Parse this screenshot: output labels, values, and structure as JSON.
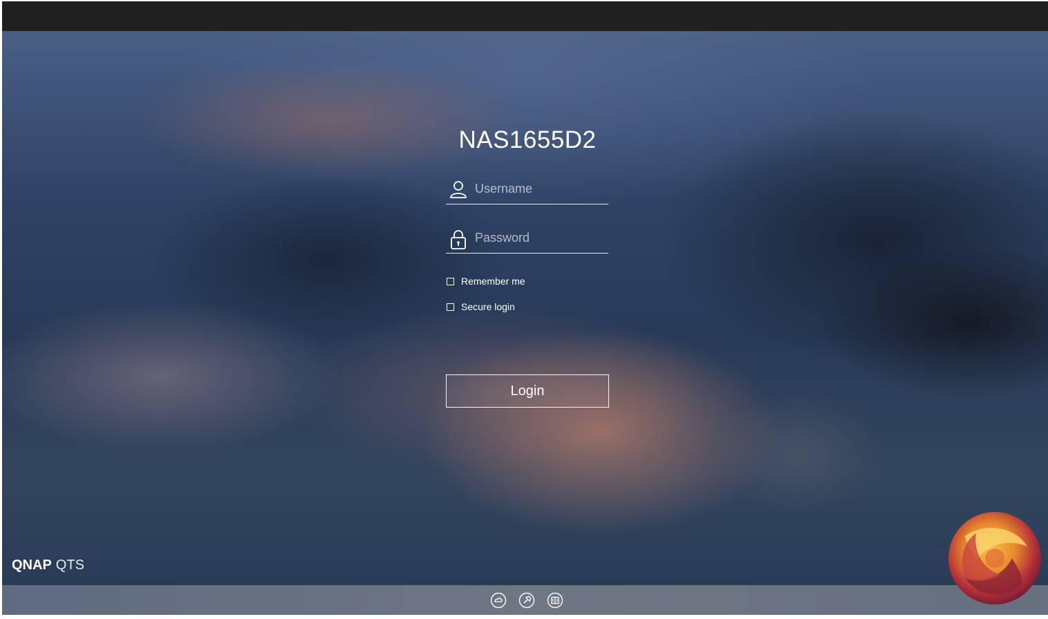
{
  "login": {
    "server_name": "NAS1655D2",
    "username_placeholder": "Username",
    "password_placeholder": "Password",
    "remember_me_label": "Remember me",
    "secure_login_label": "Secure login",
    "login_button_label": "Login"
  },
  "brand": {
    "vendor": "QNAP",
    "product": "QTS"
  },
  "footer": {
    "icons": [
      "qnap-cloud-icon",
      "helpdesk-icon",
      "docs-book-icon"
    ]
  },
  "icons": {
    "username": "user-icon",
    "password": "lock-icon"
  },
  "colors": {
    "text": "#ffffff",
    "top_bar": "#202020",
    "bottom_bar": "#6a7282"
  }
}
